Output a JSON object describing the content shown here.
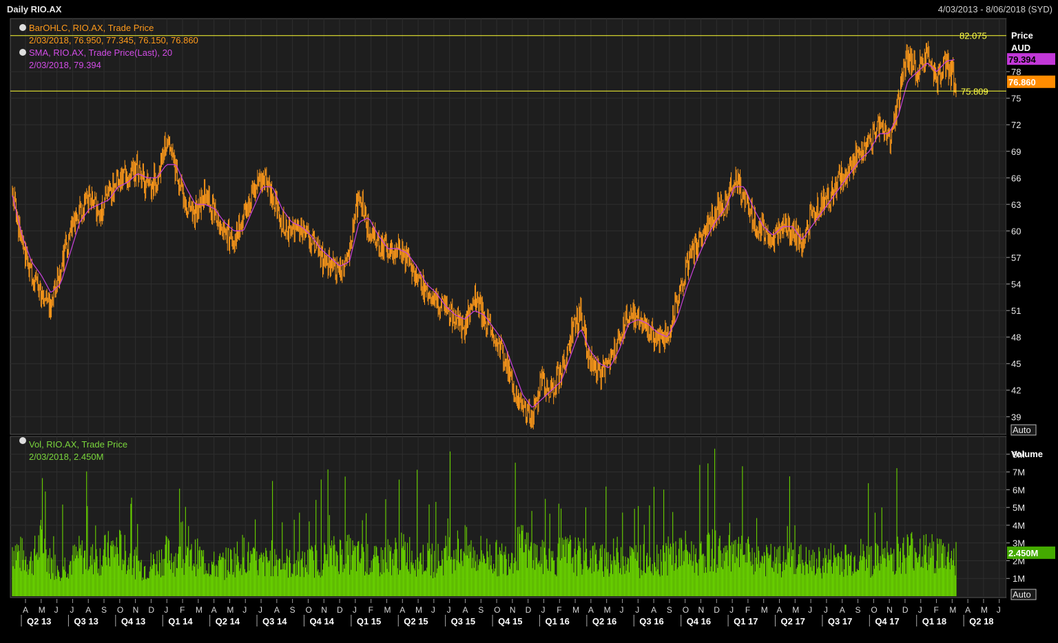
{
  "header": {
    "title": "Daily RIO.AX",
    "date_range": "4/03/2013 - 8/06/2018 (SYD)"
  },
  "legend": {
    "ohlc_label": "BarOHLC, RIO.AX, Trade Price",
    "ohlc_values": "2/03/2018, 76.950, 77.345, 76.150, 76.860",
    "sma_label": "SMA, RIO.AX, Trade Price(Last),  20",
    "sma_values": "2/03/2018, 79.394",
    "vol_label": "Vol, RIO.AX, Trade Price",
    "vol_values": "2/03/2018, 2.450M"
  },
  "price_axis": {
    "header": "Price",
    "unit": "AUD",
    "ticks": [
      "78",
      "75",
      "72",
      "69",
      "66",
      "63",
      "60",
      "57",
      "54",
      "51",
      "48",
      "45",
      "42",
      "39"
    ],
    "sma_badge": "79.394",
    "last_badge": "76.860",
    "auto_label": "Auto"
  },
  "volume_axis": {
    "header": "Volume",
    "ticks": [
      "8M",
      "7M",
      "6M",
      "5M",
      "4M",
      "3M",
      "2M",
      "1M"
    ],
    "last_badge": "2.450M",
    "auto_label": "Auto"
  },
  "hlines": {
    "high_label": "82.075",
    "low_label": "75.809"
  },
  "colors": {
    "price_bars": "#ff9a1a",
    "sma": "#c840dc",
    "volume": "#66cc00",
    "hline": "#ffff33",
    "sma_badge": "#c238d8",
    "last_badge": "#ff8c00",
    "vol_badge": "#44aa00"
  },
  "chart_data": {
    "type": "line",
    "ylim": [
      37,
      84
    ],
    "volume_ylim": [
      0,
      9
    ],
    "hlines": [
      82.075,
      75.809
    ],
    "months": [
      "A",
      "M",
      "J",
      "J",
      "A",
      "S",
      "O",
      "N",
      "D",
      "J",
      "F",
      "M",
      "A",
      "M",
      "J",
      "J",
      "A",
      "S",
      "O",
      "N",
      "D",
      "J",
      "F",
      "M",
      "A",
      "M",
      "J",
      "J",
      "A",
      "S",
      "O",
      "N",
      "D",
      "J",
      "F",
      "M",
      "A",
      "M",
      "J",
      "J",
      "A",
      "S",
      "O",
      "N",
      "D",
      "J",
      "F",
      "M",
      "A",
      "M",
      "J",
      "J",
      "A",
      "S",
      "O",
      "N",
      "D",
      "J",
      "F",
      "M",
      "A",
      "M",
      "J"
    ],
    "quarters": [
      "Q2 13",
      "Q3 13",
      "Q4 13",
      "Q1 14",
      "Q2 14",
      "Q3 14",
      "Q4 14",
      "Q1 15",
      "Q2 15",
      "Q3 15",
      "Q4 15",
      "Q1 16",
      "Q2 16",
      "Q3 16",
      "Q4 16",
      "Q1 17",
      "Q2 17",
      "Q3 17",
      "Q4 17",
      "Q1 18",
      "Q2 18"
    ],
    "series": [
      {
        "name": "BarOHLC, RIO.AX, Trade Price",
        "values": [
          64.5,
          58,
          55,
          53,
          51.5,
          56,
          60,
          62,
          63.5,
          62,
          64,
          66,
          66,
          67,
          65,
          66,
          70,
          67,
          63,
          62,
          64,
          62,
          60,
          59,
          61,
          65,
          66,
          64,
          61,
          60,
          60.5,
          59,
          57,
          56,
          55,
          58,
          64,
          60,
          59,
          57.5,
          58,
          57,
          55,
          53,
          52,
          51,
          50,
          49,
          53,
          50,
          48,
          46,
          42,
          40,
          39,
          43,
          42,
          44,
          48,
          51,
          45,
          44,
          44.5,
          48,
          51,
          50,
          49,
          48,
          48,
          52,
          56,
          58,
          60,
          62,
          63,
          66,
          64,
          61,
          60,
          59,
          61,
          60,
          58,
          62,
          63,
          64,
          66,
          67,
          69,
          70,
          72,
          70,
          75,
          80,
          78,
          80,
          77,
          79,
          76.86
        ]
      },
      {
        "name": "SMA, RIO.AX, Trade Price(Last), 20",
        "values": [
          64,
          59.5,
          56.5,
          55,
          53,
          54,
          57.5,
          61,
          62.5,
          63,
          63.5,
          65,
          65.5,
          66.5,
          66,
          66,
          67.5,
          67.5,
          65,
          63,
          63,
          62.5,
          61,
          60,
          60,
          62.5,
          65,
          65,
          62.5,
          61,
          60.5,
          59.5,
          58,
          57,
          56,
          56.5,
          61,
          61.5,
          59.5,
          58,
          58,
          57.5,
          56,
          54,
          53,
          51.5,
          50.5,
          50,
          51,
          50.5,
          49,
          47.5,
          44.5,
          41.5,
          40,
          41,
          42,
          43,
          46,
          49,
          46.5,
          45,
          44.5,
          46.5,
          49.5,
          50,
          49.5,
          48.5,
          48,
          50,
          53.5,
          56.5,
          59,
          61,
          62.5,
          65,
          65,
          62.5,
          60.5,
          59.5,
          60.5,
          60.5,
          59,
          60.5,
          62,
          63.5,
          65,
          66.5,
          68,
          69,
          71,
          71,
          73,
          77,
          78,
          79,
          78,
          79.2,
          79.394
        ]
      },
      {
        "name": "Vol, RIO.AX, Trade Price",
        "values": [
          3.1,
          2.5,
          2.2,
          3.4,
          2.0,
          1.9,
          2.1,
          2.6,
          2.3,
          2.4,
          2.8,
          3.0,
          2.4,
          2.0,
          1.8,
          2.2,
          2.6,
          2.4,
          2.1,
          2.5,
          2.2,
          1.9,
          2.0,
          2.3,
          2.7,
          2.1,
          2.0,
          2.4,
          2.2,
          2.0,
          1.9,
          2.2,
          2.3,
          2.5,
          2.7,
          2.6,
          2.4,
          2.2,
          2.1,
          2.5,
          2.6,
          2.8,
          2.4,
          2.3,
          2.2,
          2.6,
          2.9,
          3.0,
          2.5,
          2.7,
          2.4,
          2.3,
          2.8,
          3.1,
          2.6,
          2.4,
          2.2,
          2.5,
          2.7,
          2.4,
          2.5,
          2.2,
          2.3,
          2.6,
          2.4,
          2.2,
          2.3,
          2.4,
          2.5,
          2.6,
          2.8,
          2.4,
          2.7,
          2.9,
          2.6,
          2.5,
          2.6,
          2.4,
          2.3,
          2.2,
          2.1,
          2.4,
          2.2,
          2.0,
          2.1,
          2.3,
          2.4,
          2.2,
          2.5,
          2.3,
          2.2,
          2.4,
          2.6,
          2.8,
          3.0,
          2.6,
          2.7,
          2.5,
          2.45
        ]
      }
    ]
  }
}
